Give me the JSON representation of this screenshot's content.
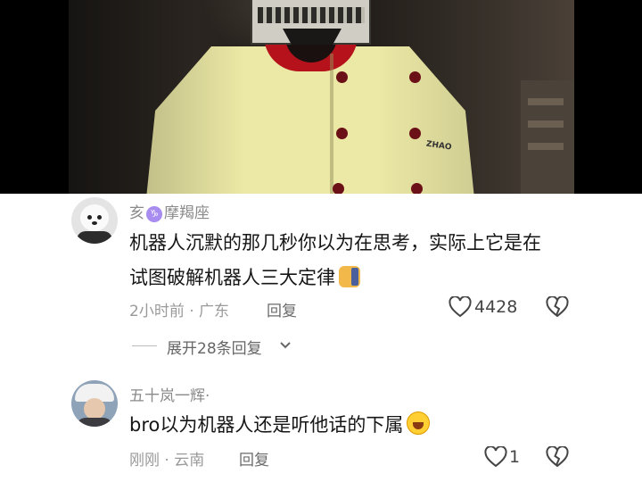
{
  "video": {
    "name_tag": "ZHAO"
  },
  "comments": [
    {
      "username": "亥",
      "zodiac_icon": "capricorn-icon",
      "zodiac_label": "摩羯座",
      "text_line1": "机器人沉默的那几秒你以为在思考，实际上它是在",
      "text_line2": "试图破解机器人三大定律",
      "emoji": "cat-emoji",
      "time": "2小时前",
      "sep": "·",
      "location": "广东",
      "reply_label": "回复",
      "likes": "4428"
    },
    {
      "username": "五十岚一辉",
      "username_suffix": "·",
      "text": "bro以为机器人还是听他话的下属",
      "emoji": "rolling-laugh-emoji",
      "time": "刚刚",
      "sep": "·",
      "location": "云南",
      "reply_label": "回复",
      "likes": "1"
    }
  ],
  "expand_replies": "展开28条回复",
  "colors": {
    "like_icon": "#444444",
    "meta_text": "#9a9a9a",
    "zodiac_badge": "#a88cf0"
  }
}
